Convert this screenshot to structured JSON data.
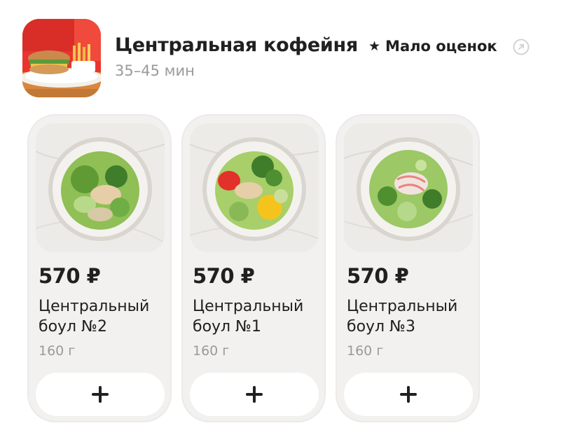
{
  "restaurant": {
    "name": "Центральная кофейня",
    "rating_label": "Мало оценок",
    "delivery_time": "35–45 мин",
    "icons": {
      "logo": "restaurant-logo",
      "rating": "star-icon",
      "share": "share-arrow-icon"
    }
  },
  "products": [
    {
      "price": "570 ₽",
      "name": "Центральный боул №2",
      "weight": "160 г",
      "add_icon": "plus-icon"
    },
    {
      "price": "570 ₽",
      "name": "Центральный боул №1",
      "weight": "160 г",
      "add_icon": "plus-icon"
    },
    {
      "price": "570 ₽",
      "name": "Центральный боул №3",
      "weight": "160 г",
      "add_icon": "plus-icon"
    }
  ],
  "colors": {
    "text_primary": "#21201f",
    "text_secondary": "#9b9a98",
    "card_bg": "#f2f1f0",
    "button_bg": "#ffffff"
  }
}
